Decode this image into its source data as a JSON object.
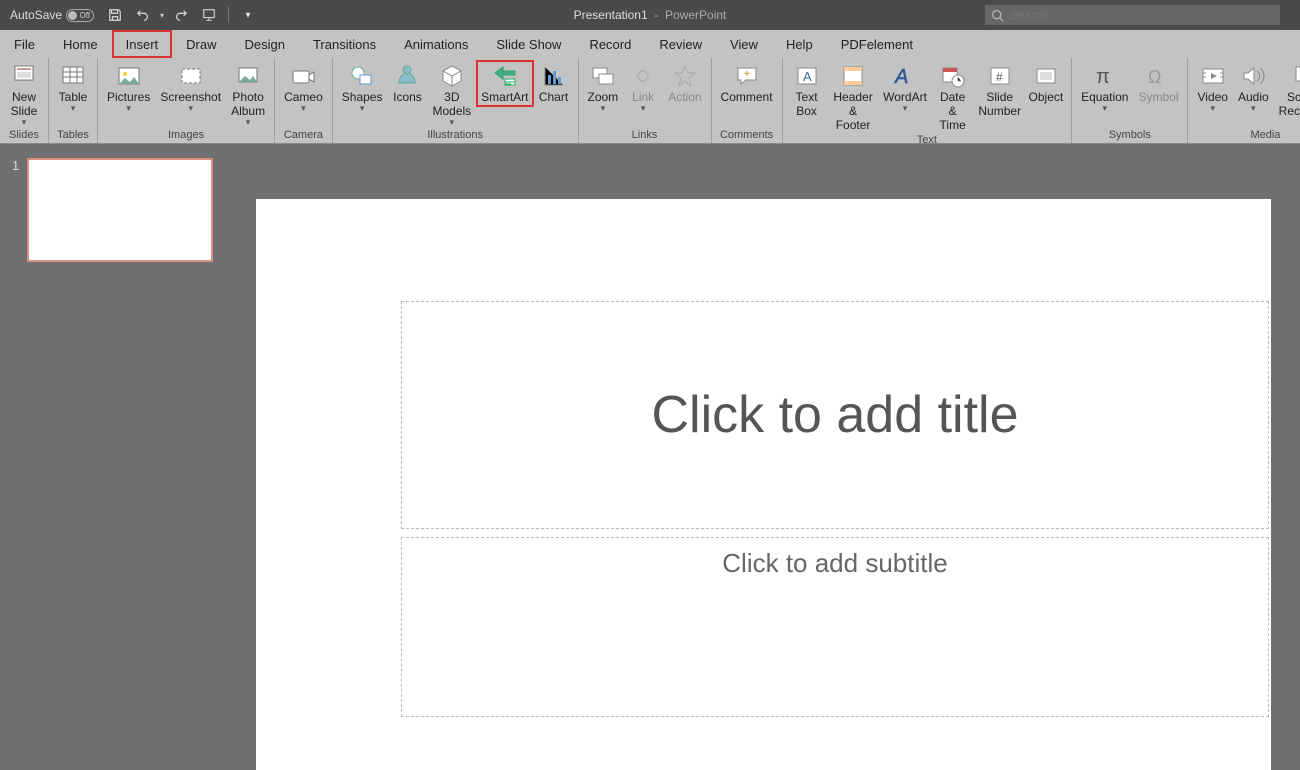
{
  "titlebar": {
    "autosave_label": "AutoSave",
    "autosave_state": "Off",
    "doc_name": "Presentation1",
    "app_name": "PowerPoint",
    "search_placeholder": "Search"
  },
  "tabs": {
    "file": "File",
    "home": "Home",
    "insert": "Insert",
    "draw": "Draw",
    "design": "Design",
    "transitions": "Transitions",
    "animations": "Animations",
    "slideshow": "Slide Show",
    "record": "Record",
    "review": "Review",
    "view": "View",
    "help": "Help",
    "pdfelement": "PDFelement"
  },
  "ribbon": {
    "slides": {
      "group": "Slides",
      "new_slide": "New\nSlide"
    },
    "tables": {
      "group": "Tables",
      "table": "Table"
    },
    "images": {
      "group": "Images",
      "pictures": "Pictures",
      "screenshot": "Screenshot",
      "photo_album": "Photo\nAlbum"
    },
    "camera": {
      "group": "Camera",
      "cameo": "Cameo"
    },
    "illustrations": {
      "group": "Illustrations",
      "shapes": "Shapes",
      "icons": "Icons",
      "models": "3D\nModels",
      "smartart": "SmartArt",
      "chart": "Chart"
    },
    "links": {
      "group": "Links",
      "zoom": "Zoom",
      "link": "Link",
      "action": "Action"
    },
    "comments": {
      "group": "Comments",
      "comment": "Comment"
    },
    "text": {
      "group": "Text",
      "textbox": "Text\nBox",
      "header": "Header\n& Footer",
      "wordart": "WordArt",
      "datetime": "Date &\nTime",
      "slidenum": "Slide\nNumber",
      "object": "Object"
    },
    "symbols": {
      "group": "Symbols",
      "equation": "Equation",
      "symbol": "Symbol"
    },
    "media": {
      "group": "Media",
      "video": "Video",
      "audio": "Audio",
      "screenrec": "Screen\nRecording"
    }
  },
  "thumbs": {
    "n1": "1"
  },
  "slide": {
    "title_placeholder": "Click to add title",
    "subtitle_placeholder": "Click to add subtitle"
  }
}
